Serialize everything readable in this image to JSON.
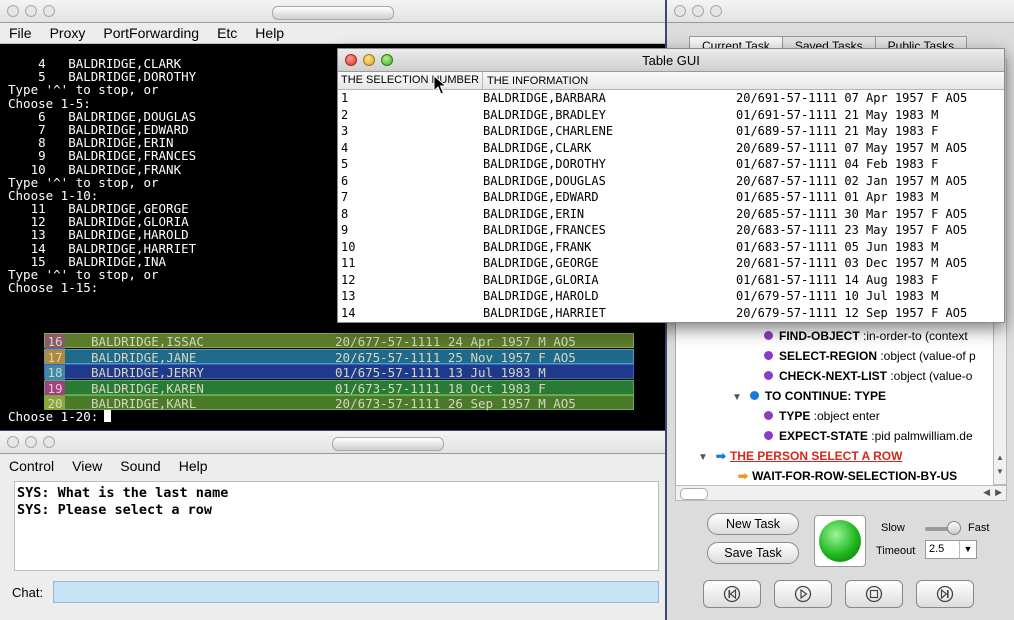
{
  "terminal": {
    "menu": [
      "File",
      "Proxy",
      "PortForwarding",
      "Etc",
      "Help"
    ],
    "lines": [
      "    4   BALDRIDGE,CLARK",
      "    5   BALDRIDGE,DOROTHY",
      "Type '^' to stop, or",
      "Choose 1-5:",
      "    6   BALDRIDGE,DOUGLAS",
      "    7   BALDRIDGE,EDWARD",
      "    8   BALDRIDGE,ERIN",
      "    9   BALDRIDGE,FRANCES",
      "   10   BALDRIDGE,FRANK",
      "Type '^' to stop, or",
      "Choose 1-10:",
      "   11   BALDRIDGE,GEORGE",
      "   12   BALDRIDGE,GLORIA",
      "   13   BALDRIDGE,HAROLD",
      "   14   BALDRIDGE,HARRIET",
      "   15   BALDRIDGE,INA",
      "Type '^' to stop, or",
      "Choose 1-15:"
    ],
    "highlight_rows": [
      {
        "num": "16",
        "name": "BALDRIDGE,ISSAC",
        "info": "20/677-57-1111 24 Apr 1957 M AO5",
        "color": "#5d7b2c",
        "border": "#8aaa4a"
      },
      {
        "num": "17",
        "name": "BALDRIDGE,JANE",
        "info": "20/675-57-1111 25 Nov 1957 F AO5",
        "color": "#1f6a8a",
        "border": "#3fa0c8"
      },
      {
        "num": "18",
        "name": "BALDRIDGE,JERRY",
        "info": "01/675-57-1111 13 Jul 1983 M",
        "color": "#1f3a8a",
        "border": "#4060c0"
      },
      {
        "num": "19",
        "name": "BALDRIDGE,KAREN",
        "info": "01/673-57-1111 18 Oct 1983 F",
        "color": "#2a7a36",
        "border": "#4ab050"
      },
      {
        "num": "20",
        "name": "BALDRIDGE,KARL",
        "info": "20/673-57-1111 26 Sep 1957 M AO5",
        "color": "#4a7a2a",
        "border": "#7aaa48"
      }
    ],
    "num_colors": [
      "#8a5a6a",
      "#b08a3a",
      "#3a8aa8",
      "#a83a8a",
      "#8aa83a"
    ],
    "prompt": "Choose 1-20:"
  },
  "chat_window": {
    "menu": [
      "Control",
      "View",
      "Sound",
      "Help"
    ],
    "messages": [
      "SYS: What is the last name",
      "SYS: Please select a row"
    ],
    "chat_label": "Chat:",
    "chat_value": ""
  },
  "table_gui": {
    "title": "Table GUI",
    "headers": [
      "THE SELECTION NUMBER",
      "THE INFORMATION"
    ],
    "rows": [
      [
        "1",
        "BALDRIDGE,BARBARA",
        "20/691-57-1111 07 Apr 1957 F AO5"
      ],
      [
        "2",
        "BALDRIDGE,BRADLEY",
        "01/691-57-1111 21 May 1983 M"
      ],
      [
        "3",
        "BALDRIDGE,CHARLENE",
        "01/689-57-1111 21 May 1983 F"
      ],
      [
        "4",
        "BALDRIDGE,CLARK",
        "20/689-57-1111 07 May 1957 M AO5"
      ],
      [
        "5",
        "BALDRIDGE,DOROTHY",
        "01/687-57-1111 04 Feb 1983 F"
      ],
      [
        "6",
        "BALDRIDGE,DOUGLAS",
        "20/687-57-1111 02 Jan 1957 M AO5"
      ],
      [
        "7",
        "BALDRIDGE,EDWARD",
        "01/685-57-1111 01 Apr 1983 M"
      ],
      [
        "8",
        "BALDRIDGE,ERIN",
        "20/685-57-1111 30 Mar 1957 F AO5"
      ],
      [
        "9",
        "BALDRIDGE,FRANCES",
        "20/683-57-1111 23 May 1957 F AO5"
      ],
      [
        "10",
        "BALDRIDGE,FRANK",
        "01/683-57-1111 05 Jun 1983 M"
      ],
      [
        "11",
        "BALDRIDGE,GEORGE",
        "20/681-57-1111 03 Dec 1957 M AO5"
      ],
      [
        "12",
        "BALDRIDGE,GLORIA",
        "01/681-57-1111 14 Aug 1983 F"
      ],
      [
        "13",
        "BALDRIDGE,HAROLD",
        "01/679-57-1111 10 Jul 1983 M"
      ],
      [
        "14",
        "BALDRIDGE,HARRIET",
        "20/679-57-1111 12 Sep 1957 F AO5"
      ]
    ]
  },
  "task_panel": {
    "tabs": [
      "Current Task",
      "Saved Tasks",
      "Public Tasks"
    ],
    "tree": [
      {
        "label": "FIND-OBJECT",
        "detail": " :in-order-to (context",
        "kind": "purple"
      },
      {
        "label": "SELECT-REGION",
        "detail": " :object (value-of p",
        "kind": "purple"
      },
      {
        "label": "CHECK-NEXT-LIST",
        "detail": " :object (value-o",
        "kind": "purple"
      },
      {
        "label": "TO CONTINUE: TYPE",
        "detail": "",
        "kind": "blue"
      },
      {
        "label": "TYPE",
        "detail": " :object enter",
        "kind": "purple"
      },
      {
        "label": "EXPECT-STATE",
        "detail": " :pid palmwilliam.de",
        "kind": "purple"
      },
      {
        "label": "THE PERSON SELECT A ROW",
        "detail": "",
        "kind": "arrow-blue"
      },
      {
        "label": "WAIT-FOR-ROW-SELECTION-BY-US",
        "detail": "",
        "kind": "arrow-orange"
      }
    ],
    "new_task": "New Task",
    "save_task": "Save Task",
    "slow": "Slow",
    "fast": "Fast",
    "timeout_label": "Timeout",
    "timeout_value": "2.5",
    "speed_level": 0.8
  },
  "colors": {
    "chat_input": "#c5e3f5",
    "red_link": "#d8271a",
    "purple": "#8a3cc8",
    "blue": "#1a7ad8",
    "orange": "#f0931e",
    "green": "#1fb81f"
  }
}
